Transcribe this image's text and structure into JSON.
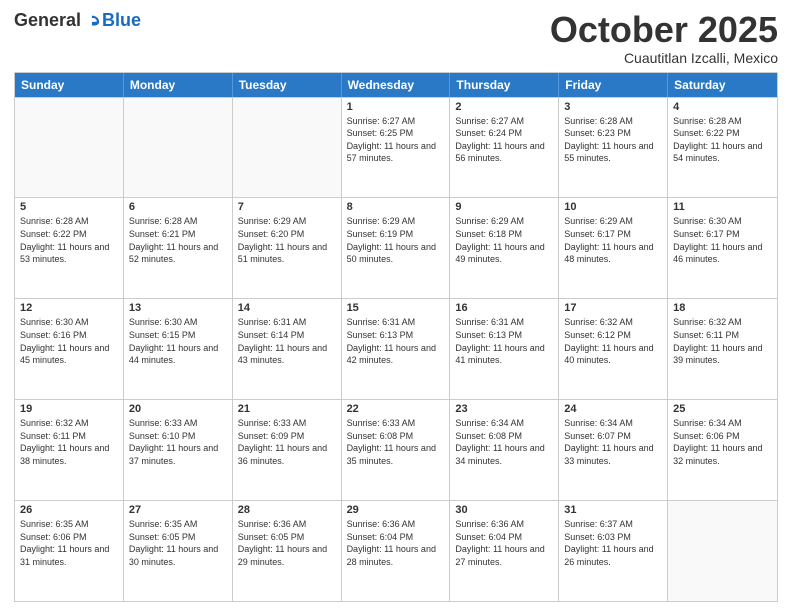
{
  "header": {
    "logo_general": "General",
    "logo_blue": "Blue",
    "month_title": "October 2025",
    "location": "Cuautitlan Izcalli, Mexico"
  },
  "days_of_week": [
    "Sunday",
    "Monday",
    "Tuesday",
    "Wednesday",
    "Thursday",
    "Friday",
    "Saturday"
  ],
  "weeks": [
    [
      {
        "day": "",
        "sunrise": "",
        "sunset": "",
        "daylight": ""
      },
      {
        "day": "",
        "sunrise": "",
        "sunset": "",
        "daylight": ""
      },
      {
        "day": "",
        "sunrise": "",
        "sunset": "",
        "daylight": ""
      },
      {
        "day": "1",
        "sunrise": "Sunrise: 6:27 AM",
        "sunset": "Sunset: 6:25 PM",
        "daylight": "Daylight: 11 hours and 57 minutes."
      },
      {
        "day": "2",
        "sunrise": "Sunrise: 6:27 AM",
        "sunset": "Sunset: 6:24 PM",
        "daylight": "Daylight: 11 hours and 56 minutes."
      },
      {
        "day": "3",
        "sunrise": "Sunrise: 6:28 AM",
        "sunset": "Sunset: 6:23 PM",
        "daylight": "Daylight: 11 hours and 55 minutes."
      },
      {
        "day": "4",
        "sunrise": "Sunrise: 6:28 AM",
        "sunset": "Sunset: 6:22 PM",
        "daylight": "Daylight: 11 hours and 54 minutes."
      }
    ],
    [
      {
        "day": "5",
        "sunrise": "Sunrise: 6:28 AM",
        "sunset": "Sunset: 6:22 PM",
        "daylight": "Daylight: 11 hours and 53 minutes."
      },
      {
        "day": "6",
        "sunrise": "Sunrise: 6:28 AM",
        "sunset": "Sunset: 6:21 PM",
        "daylight": "Daylight: 11 hours and 52 minutes."
      },
      {
        "day": "7",
        "sunrise": "Sunrise: 6:29 AM",
        "sunset": "Sunset: 6:20 PM",
        "daylight": "Daylight: 11 hours and 51 minutes."
      },
      {
        "day": "8",
        "sunrise": "Sunrise: 6:29 AM",
        "sunset": "Sunset: 6:19 PM",
        "daylight": "Daylight: 11 hours and 50 minutes."
      },
      {
        "day": "9",
        "sunrise": "Sunrise: 6:29 AM",
        "sunset": "Sunset: 6:18 PM",
        "daylight": "Daylight: 11 hours and 49 minutes."
      },
      {
        "day": "10",
        "sunrise": "Sunrise: 6:29 AM",
        "sunset": "Sunset: 6:17 PM",
        "daylight": "Daylight: 11 hours and 48 minutes."
      },
      {
        "day": "11",
        "sunrise": "Sunrise: 6:30 AM",
        "sunset": "Sunset: 6:17 PM",
        "daylight": "Daylight: 11 hours and 46 minutes."
      }
    ],
    [
      {
        "day": "12",
        "sunrise": "Sunrise: 6:30 AM",
        "sunset": "Sunset: 6:16 PM",
        "daylight": "Daylight: 11 hours and 45 minutes."
      },
      {
        "day": "13",
        "sunrise": "Sunrise: 6:30 AM",
        "sunset": "Sunset: 6:15 PM",
        "daylight": "Daylight: 11 hours and 44 minutes."
      },
      {
        "day": "14",
        "sunrise": "Sunrise: 6:31 AM",
        "sunset": "Sunset: 6:14 PM",
        "daylight": "Daylight: 11 hours and 43 minutes."
      },
      {
        "day": "15",
        "sunrise": "Sunrise: 6:31 AM",
        "sunset": "Sunset: 6:13 PM",
        "daylight": "Daylight: 11 hours and 42 minutes."
      },
      {
        "day": "16",
        "sunrise": "Sunrise: 6:31 AM",
        "sunset": "Sunset: 6:13 PM",
        "daylight": "Daylight: 11 hours and 41 minutes."
      },
      {
        "day": "17",
        "sunrise": "Sunrise: 6:32 AM",
        "sunset": "Sunset: 6:12 PM",
        "daylight": "Daylight: 11 hours and 40 minutes."
      },
      {
        "day": "18",
        "sunrise": "Sunrise: 6:32 AM",
        "sunset": "Sunset: 6:11 PM",
        "daylight": "Daylight: 11 hours and 39 minutes."
      }
    ],
    [
      {
        "day": "19",
        "sunrise": "Sunrise: 6:32 AM",
        "sunset": "Sunset: 6:11 PM",
        "daylight": "Daylight: 11 hours and 38 minutes."
      },
      {
        "day": "20",
        "sunrise": "Sunrise: 6:33 AM",
        "sunset": "Sunset: 6:10 PM",
        "daylight": "Daylight: 11 hours and 37 minutes."
      },
      {
        "day": "21",
        "sunrise": "Sunrise: 6:33 AM",
        "sunset": "Sunset: 6:09 PM",
        "daylight": "Daylight: 11 hours and 36 minutes."
      },
      {
        "day": "22",
        "sunrise": "Sunrise: 6:33 AM",
        "sunset": "Sunset: 6:08 PM",
        "daylight": "Daylight: 11 hours and 35 minutes."
      },
      {
        "day": "23",
        "sunrise": "Sunrise: 6:34 AM",
        "sunset": "Sunset: 6:08 PM",
        "daylight": "Daylight: 11 hours and 34 minutes."
      },
      {
        "day": "24",
        "sunrise": "Sunrise: 6:34 AM",
        "sunset": "Sunset: 6:07 PM",
        "daylight": "Daylight: 11 hours and 33 minutes."
      },
      {
        "day": "25",
        "sunrise": "Sunrise: 6:34 AM",
        "sunset": "Sunset: 6:06 PM",
        "daylight": "Daylight: 11 hours and 32 minutes."
      }
    ],
    [
      {
        "day": "26",
        "sunrise": "Sunrise: 6:35 AM",
        "sunset": "Sunset: 6:06 PM",
        "daylight": "Daylight: 11 hours and 31 minutes."
      },
      {
        "day": "27",
        "sunrise": "Sunrise: 6:35 AM",
        "sunset": "Sunset: 6:05 PM",
        "daylight": "Daylight: 11 hours and 30 minutes."
      },
      {
        "day": "28",
        "sunrise": "Sunrise: 6:36 AM",
        "sunset": "Sunset: 6:05 PM",
        "daylight": "Daylight: 11 hours and 29 minutes."
      },
      {
        "day": "29",
        "sunrise": "Sunrise: 6:36 AM",
        "sunset": "Sunset: 6:04 PM",
        "daylight": "Daylight: 11 hours and 28 minutes."
      },
      {
        "day": "30",
        "sunrise": "Sunrise: 6:36 AM",
        "sunset": "Sunset: 6:04 PM",
        "daylight": "Daylight: 11 hours and 27 minutes."
      },
      {
        "day": "31",
        "sunrise": "Sunrise: 6:37 AM",
        "sunset": "Sunset: 6:03 PM",
        "daylight": "Daylight: 11 hours and 26 minutes."
      },
      {
        "day": "",
        "sunrise": "",
        "sunset": "",
        "daylight": ""
      }
    ]
  ]
}
